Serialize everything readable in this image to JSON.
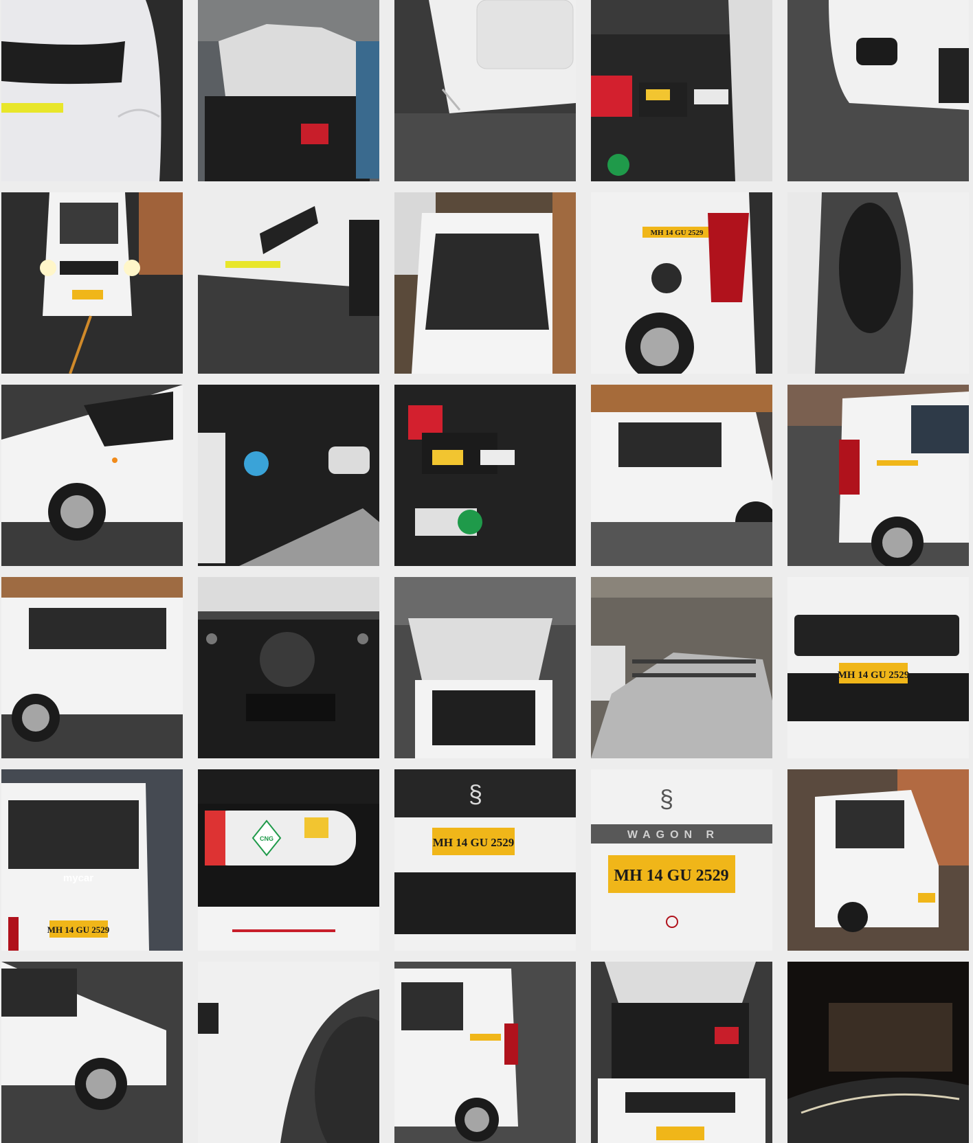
{
  "plate_number": "MH 14 GU 2529",
  "badges": {
    "cng": "CNG",
    "mycar": "mycar",
    "grille_letters": "WAGON R"
  },
  "colors": {
    "page_background": "#ededed",
    "car_white": "#f2f2f2",
    "plate_yellow": "#f0b619",
    "tail_red": "#b0121c",
    "battery_red": "#d3202e",
    "coolant_green": "#1f9a4a",
    "cng_blue": "#3a7fa8",
    "garage_dark": "#2b2b2b"
  }
}
